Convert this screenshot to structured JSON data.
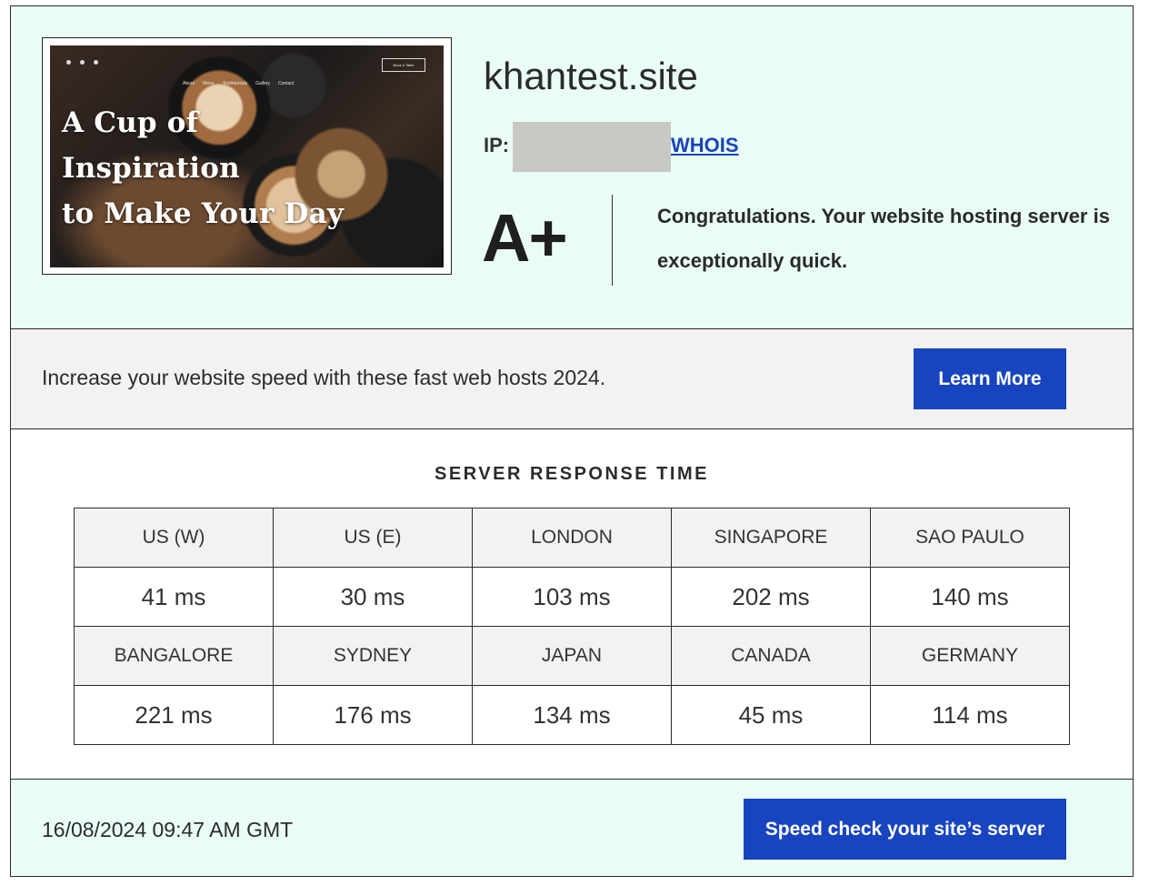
{
  "site": {
    "thumbnail": {
      "headline_lines": [
        "A Cup of",
        "Inspiration",
        "to Make Your Day"
      ],
      "nav": [
        "About",
        "Menu",
        "Testimonials",
        "Gallery",
        "Contact"
      ],
      "book_button": "Book a Table"
    },
    "name": "khantest.site",
    "ip_label": "IP:",
    "whois_label": "WHOIS"
  },
  "grade": {
    "value": "A+",
    "message": "Congratulations. Your website hosting server is exceptionally quick."
  },
  "promo": {
    "text": "Increase your website speed with these fast web hosts 2024.",
    "button": "Learn More"
  },
  "response_time": {
    "title": "SERVER RESPONSE TIME",
    "rows": [
      {
        "locations": [
          "US (W)",
          "US (E)",
          "LONDON",
          "SINGAPORE",
          "SAO PAULO"
        ],
        "times": [
          "41 ms",
          "30 ms",
          "103 ms",
          "202 ms",
          "140 ms"
        ]
      },
      {
        "locations": [
          "BANGALORE",
          "SYDNEY",
          "JAPAN",
          "CANADA",
          "GERMANY"
        ],
        "times": [
          "221 ms",
          "176 ms",
          "134 ms",
          "45 ms",
          "114 ms"
        ]
      }
    ]
  },
  "footer": {
    "timestamp": "16/08/2024 09:47 AM GMT",
    "button": "Speed check your site’s server"
  },
  "colors": {
    "accent": "#1845bf",
    "mint_background": "#e9fdf6",
    "gray_background": "#f2f2f2",
    "redaction": "#c8c8c4"
  }
}
